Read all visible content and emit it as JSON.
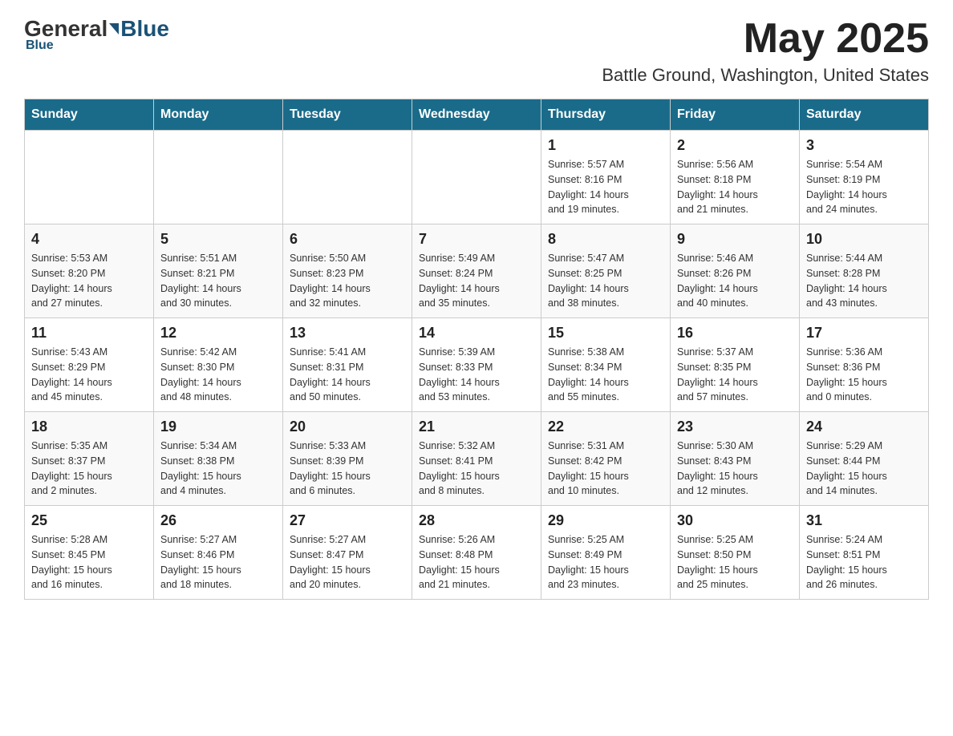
{
  "header": {
    "logo_general": "General",
    "logo_blue": "Blue",
    "month_title": "May 2025",
    "location": "Battle Ground, Washington, United States"
  },
  "days_of_week": [
    "Sunday",
    "Monday",
    "Tuesday",
    "Wednesday",
    "Thursday",
    "Friday",
    "Saturday"
  ],
  "weeks": [
    {
      "days": [
        {
          "number": "",
          "info": ""
        },
        {
          "number": "",
          "info": ""
        },
        {
          "number": "",
          "info": ""
        },
        {
          "number": "",
          "info": ""
        },
        {
          "number": "1",
          "info": "Sunrise: 5:57 AM\nSunset: 8:16 PM\nDaylight: 14 hours\nand 19 minutes."
        },
        {
          "number": "2",
          "info": "Sunrise: 5:56 AM\nSunset: 8:18 PM\nDaylight: 14 hours\nand 21 minutes."
        },
        {
          "number": "3",
          "info": "Sunrise: 5:54 AM\nSunset: 8:19 PM\nDaylight: 14 hours\nand 24 minutes."
        }
      ]
    },
    {
      "days": [
        {
          "number": "4",
          "info": "Sunrise: 5:53 AM\nSunset: 8:20 PM\nDaylight: 14 hours\nand 27 minutes."
        },
        {
          "number": "5",
          "info": "Sunrise: 5:51 AM\nSunset: 8:21 PM\nDaylight: 14 hours\nand 30 minutes."
        },
        {
          "number": "6",
          "info": "Sunrise: 5:50 AM\nSunset: 8:23 PM\nDaylight: 14 hours\nand 32 minutes."
        },
        {
          "number": "7",
          "info": "Sunrise: 5:49 AM\nSunset: 8:24 PM\nDaylight: 14 hours\nand 35 minutes."
        },
        {
          "number": "8",
          "info": "Sunrise: 5:47 AM\nSunset: 8:25 PM\nDaylight: 14 hours\nand 38 minutes."
        },
        {
          "number": "9",
          "info": "Sunrise: 5:46 AM\nSunset: 8:26 PM\nDaylight: 14 hours\nand 40 minutes."
        },
        {
          "number": "10",
          "info": "Sunrise: 5:44 AM\nSunset: 8:28 PM\nDaylight: 14 hours\nand 43 minutes."
        }
      ]
    },
    {
      "days": [
        {
          "number": "11",
          "info": "Sunrise: 5:43 AM\nSunset: 8:29 PM\nDaylight: 14 hours\nand 45 minutes."
        },
        {
          "number": "12",
          "info": "Sunrise: 5:42 AM\nSunset: 8:30 PM\nDaylight: 14 hours\nand 48 minutes."
        },
        {
          "number": "13",
          "info": "Sunrise: 5:41 AM\nSunset: 8:31 PM\nDaylight: 14 hours\nand 50 minutes."
        },
        {
          "number": "14",
          "info": "Sunrise: 5:39 AM\nSunset: 8:33 PM\nDaylight: 14 hours\nand 53 minutes."
        },
        {
          "number": "15",
          "info": "Sunrise: 5:38 AM\nSunset: 8:34 PM\nDaylight: 14 hours\nand 55 minutes."
        },
        {
          "number": "16",
          "info": "Sunrise: 5:37 AM\nSunset: 8:35 PM\nDaylight: 14 hours\nand 57 minutes."
        },
        {
          "number": "17",
          "info": "Sunrise: 5:36 AM\nSunset: 8:36 PM\nDaylight: 15 hours\nand 0 minutes."
        }
      ]
    },
    {
      "days": [
        {
          "number": "18",
          "info": "Sunrise: 5:35 AM\nSunset: 8:37 PM\nDaylight: 15 hours\nand 2 minutes."
        },
        {
          "number": "19",
          "info": "Sunrise: 5:34 AM\nSunset: 8:38 PM\nDaylight: 15 hours\nand 4 minutes."
        },
        {
          "number": "20",
          "info": "Sunrise: 5:33 AM\nSunset: 8:39 PM\nDaylight: 15 hours\nand 6 minutes."
        },
        {
          "number": "21",
          "info": "Sunrise: 5:32 AM\nSunset: 8:41 PM\nDaylight: 15 hours\nand 8 minutes."
        },
        {
          "number": "22",
          "info": "Sunrise: 5:31 AM\nSunset: 8:42 PM\nDaylight: 15 hours\nand 10 minutes."
        },
        {
          "number": "23",
          "info": "Sunrise: 5:30 AM\nSunset: 8:43 PM\nDaylight: 15 hours\nand 12 minutes."
        },
        {
          "number": "24",
          "info": "Sunrise: 5:29 AM\nSunset: 8:44 PM\nDaylight: 15 hours\nand 14 minutes."
        }
      ]
    },
    {
      "days": [
        {
          "number": "25",
          "info": "Sunrise: 5:28 AM\nSunset: 8:45 PM\nDaylight: 15 hours\nand 16 minutes."
        },
        {
          "number": "26",
          "info": "Sunrise: 5:27 AM\nSunset: 8:46 PM\nDaylight: 15 hours\nand 18 minutes."
        },
        {
          "number": "27",
          "info": "Sunrise: 5:27 AM\nSunset: 8:47 PM\nDaylight: 15 hours\nand 20 minutes."
        },
        {
          "number": "28",
          "info": "Sunrise: 5:26 AM\nSunset: 8:48 PM\nDaylight: 15 hours\nand 21 minutes."
        },
        {
          "number": "29",
          "info": "Sunrise: 5:25 AM\nSunset: 8:49 PM\nDaylight: 15 hours\nand 23 minutes."
        },
        {
          "number": "30",
          "info": "Sunrise: 5:25 AM\nSunset: 8:50 PM\nDaylight: 15 hours\nand 25 minutes."
        },
        {
          "number": "31",
          "info": "Sunrise: 5:24 AM\nSunset: 8:51 PM\nDaylight: 15 hours\nand 26 minutes."
        }
      ]
    }
  ]
}
